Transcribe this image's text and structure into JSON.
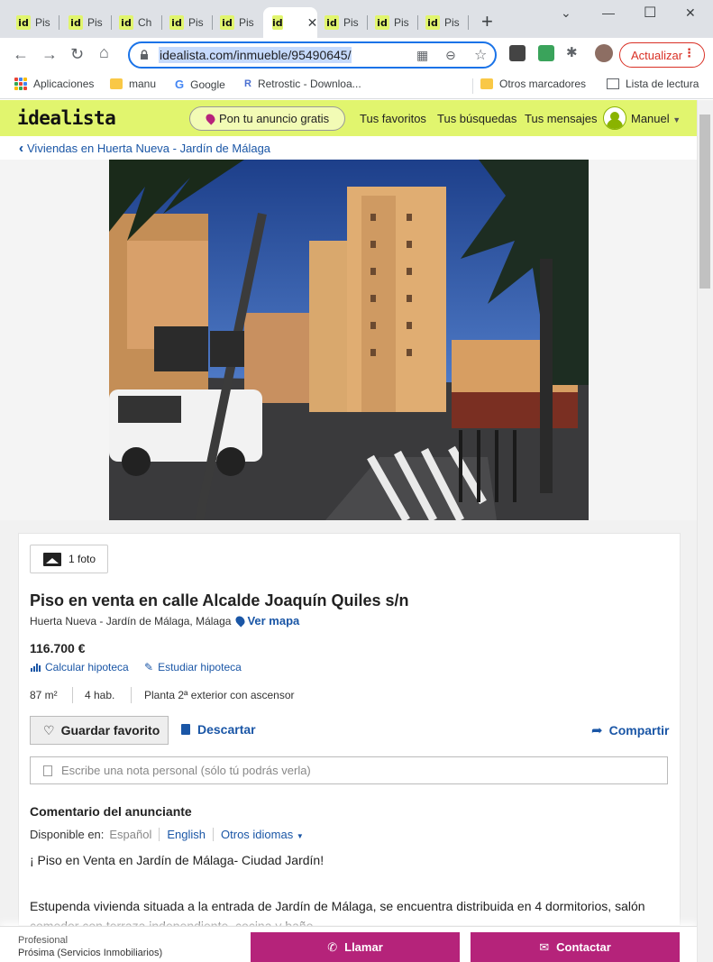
{
  "browser": {
    "tabs": [
      {
        "label": "Pis",
        "active": false
      },
      {
        "label": "Pis",
        "active": false
      },
      {
        "label": "Ch",
        "active": false
      },
      {
        "label": "Pis",
        "active": false
      },
      {
        "label": "Pis",
        "active": false
      },
      {
        "label": "",
        "active": true
      },
      {
        "label": "Pis",
        "active": false
      },
      {
        "label": "Pis",
        "active": false
      },
      {
        "label": "Pis",
        "active": false
      }
    ],
    "favicon_text": "id",
    "url": "idealista.com/inmueble/95490645/",
    "update_label": "Actualizar",
    "bookmarks": {
      "apps": "Aplicaciones",
      "manu": "manu",
      "google": "Google",
      "retrostic": "Retrostic - Downloa...",
      "other": "Otros marcadores",
      "reading_list": "Lista de lectura"
    }
  },
  "header": {
    "logo": "idealista",
    "publish": "Pon tu anuncio gratis",
    "favorites": "Tus favoritos",
    "searches": "Tus búsquedas",
    "messages": "Tus mensajes",
    "user": "Manuel"
  },
  "breadcrumb": "Viviendas en Huerta Nueva - Jardín de Málaga",
  "listing": {
    "photo_count": "1 foto",
    "title": "Piso en venta en calle Alcalde Joaquín Quiles s/n",
    "location": "Huerta Nueva - Jardín de Málaga, Málaga",
    "map_link": "Ver mapa",
    "price": "116.700 €",
    "mortgage_calc": "Calcular hipoteca",
    "mortgage_study": "Estudiar hipoteca",
    "features": [
      "87 m²",
      "4 hab.",
      "Planta 2ª exterior con ascensor"
    ],
    "save_favorite": "Guardar favorito",
    "discard": "Descartar",
    "share": "Compartir",
    "note_placeholder": "Escribe una nota personal (sólo tú podrás verla)",
    "comment_title": "Comentario del anunciante",
    "available_in": "Disponible en:",
    "languages": [
      "Español",
      "English",
      "Otros idiomas"
    ],
    "description_1": "¡ Piso en Venta en Jardín de Málaga- Ciudad Jardín!",
    "description_2": "Estupenda vivienda situada a la entrada de Jardín de Málaga, se encuentra distribuida en 4 dormitorios, salón comedor con terraza independiente, cocina y baño."
  },
  "contact_bar": {
    "type": "Profesional",
    "agency": "Prósima (Servicios Inmobiliarios)",
    "call": "Llamar",
    "contact": "Contactar"
  },
  "colors": {
    "brand_yellow": "#e1f56e",
    "brand_magenta": "#b5237a",
    "link_blue": "#1a56a6"
  }
}
